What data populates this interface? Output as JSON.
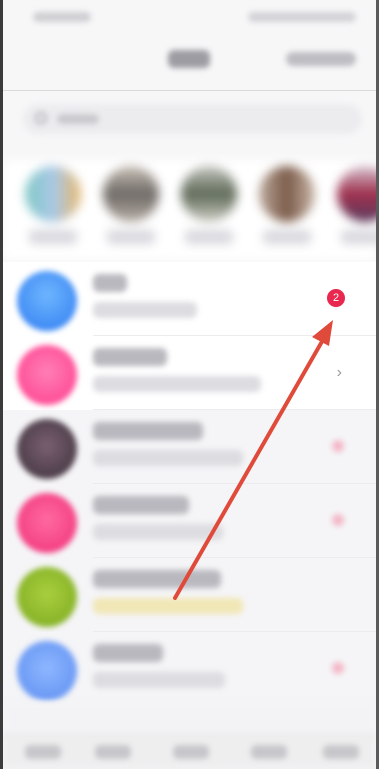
{
  "messages": {
    "top_chat": {
      "unread_badge": "2"
    },
    "second_chat": {
      "chevron": "›"
    }
  },
  "colors": {
    "background": "#f7f7f8",
    "badge": "#e8284e",
    "annotation_arrow": "#e04a3a"
  },
  "icons": {
    "search": "search-icon",
    "chevron": "chevron-right-icon",
    "annotation": "arrow-annotation"
  }
}
